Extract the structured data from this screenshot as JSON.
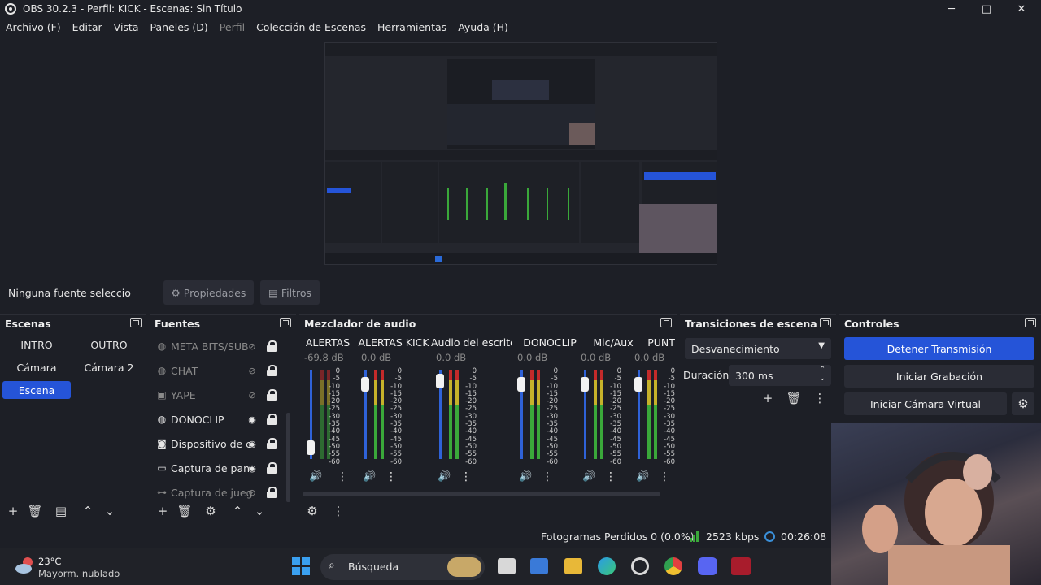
{
  "window": {
    "title": "OBS 30.2.3 - Perfil: KICK - Escenas: Sin Título",
    "controls": {
      "minimize": "─",
      "maximize": "□",
      "close": "✕"
    }
  },
  "menubar": [
    {
      "label": "Archivo (F)",
      "enabled": true
    },
    {
      "label": "Editar",
      "enabled": true
    },
    {
      "label": "Vista",
      "enabled": true
    },
    {
      "label": "Paneles (D)",
      "enabled": true
    },
    {
      "label": "Perfil",
      "enabled": false
    },
    {
      "label": "Colección de Escenas",
      "enabled": true
    },
    {
      "label": "Herramientas",
      "enabled": true
    },
    {
      "label": "Ayuda (H)",
      "enabled": true
    }
  ],
  "source_toolbar": {
    "no_source": "Ninguna fuente seleccionad",
    "properties": "Propiedades",
    "filters": "Filtros"
  },
  "scenes": {
    "title": "Escenas",
    "items": [
      "INTRO",
      "OUTRO",
      "Cámara",
      "Cámara 2",
      "Escena"
    ],
    "selected": "Escena"
  },
  "sources": {
    "title": "Fuentes",
    "items": [
      {
        "label": "META BITS/SUB",
        "icon": "browser-icon",
        "visible": false
      },
      {
        "label": "CHAT",
        "icon": "browser-icon",
        "visible": false
      },
      {
        "label": "YAPE",
        "icon": "image-icon",
        "visible": false
      },
      {
        "label": "DONOCLIP",
        "icon": "browser-icon",
        "visible": true
      },
      {
        "label": "Dispositivo de c",
        "icon": "camera-icon",
        "visible": true
      },
      {
        "label": "Captura de pan",
        "icon": "monitor-icon",
        "visible": true
      },
      {
        "label": "Captura de jueg",
        "icon": "gamepad-icon",
        "visible": false
      }
    ]
  },
  "mixer": {
    "title": "Mezclador de audio",
    "scale": [
      "0",
      "-5",
      "-10",
      "-15",
      "-20",
      "-25",
      "-30",
      "-35",
      "-40",
      "-45",
      "-50",
      "-55",
      "-60"
    ],
    "channels": [
      {
        "name": "ALERTAS",
        "db": "-69.8 dB",
        "level": 0.05
      },
      {
        "name": "ALERTAS KICK",
        "db": "0.0 dB",
        "level": 0.9
      },
      {
        "name": "Audio del escrito",
        "db": "0.0 dB",
        "level": 0.95
      },
      {
        "name": "DONOCLIP",
        "db": "0.0 dB",
        "level": 0.9
      },
      {
        "name": "Mic/Aux",
        "db": "0.0 dB",
        "level": 0.9
      },
      {
        "name": "PUNTO:",
        "db": "0.0 dB",
        "level": 0.9
      }
    ]
  },
  "transitions": {
    "title": "Transiciones de escena",
    "selected": "Desvanecimiento",
    "duration_label": "Duración",
    "duration_value": "300 ms"
  },
  "controls": {
    "title": "Controles",
    "stop_stream": "Detener Transmisión",
    "start_recording": "Iniciar Grabación",
    "start_virtual_cam": "Iniciar Cámara Virtual"
  },
  "status": {
    "dropped_frames": "Fotogramas Perdidos 0 (0.0%)",
    "bitrate": "2523 kbps",
    "time": "00:26:08"
  },
  "taskbar": {
    "temperature": "23°C",
    "weather": "Mayorm. nublado",
    "search_placeholder": "Búsqueda"
  },
  "colors": {
    "accent": "#2554d8",
    "background": "#1d1f26",
    "panel": "#2a2c35"
  }
}
